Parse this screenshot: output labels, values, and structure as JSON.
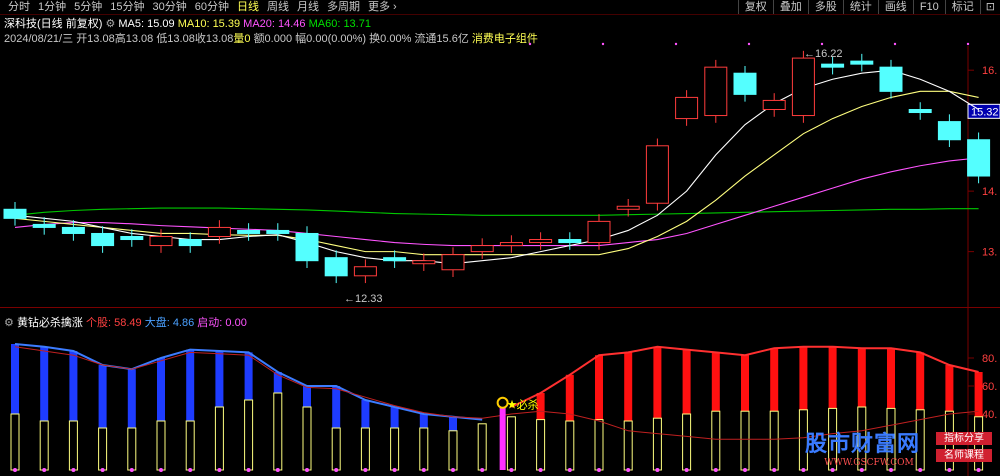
{
  "topbar": {
    "periods": [
      "分时",
      "1分钟",
      "5分钟",
      "15分钟",
      "30分钟",
      "60分钟",
      "日线",
      "周线",
      "月线",
      "多周期",
      "更多 ›"
    ],
    "active_period": "日线",
    "tools": [
      "复权",
      "叠加",
      "多股",
      "统计",
      "画线",
      "F10",
      "标记"
    ],
    "icon": "expand-icon"
  },
  "header": {
    "stock": "深科技(日线 前复权)",
    "ma5": "MA5: 15.09",
    "ma10": "MA10: 15.39",
    "ma20": "MA20: 14.46",
    "ma60": "MA60: 13.71",
    "date": "2024/08/21/三",
    "open": "开13.08",
    "high": "高13.08",
    "low": "低13.08",
    "close": "收13.08",
    "vol": "量0",
    "amount": "额0.000",
    "range": "幅0.00(0.00%)",
    "turnover": "换0.00%",
    "float": "流通15.6亿",
    "sector": "消费电子组件"
  },
  "price_axis": {
    "labels": [
      "16.",
      "14.",
      "13."
    ],
    "current": "15.32",
    "high_label": "16.22",
    "low_label": "12.33"
  },
  "indicator": {
    "name": "黄钻必杀擒涨",
    "stock_label": "个股: 58.49",
    "market_label": "大盘: 4.86",
    "start_label": "启动: 0.00",
    "signal": "必杀",
    "axis": [
      "80.",
      "60.",
      "40."
    ]
  },
  "colors": {
    "up": "#ff3c3c",
    "down": "#54ffff",
    "ma5": "#ffffff",
    "ma10": "#ffff7f",
    "ma20": "#ff54ff",
    "ma60": "#00c800",
    "bar_blue": "#1e3cff",
    "bar_red": "#ff1010"
  },
  "watermark": {
    "text": "股市财富网",
    "url": "WWW.GSCFW.COM",
    "tag1": "指标分享",
    "tag2": "名师课程"
  },
  "chart_data": {
    "type": "candlestick",
    "candles": [
      {
        "o": 13.7,
        "c": 13.55
      },
      {
        "o": 13.45,
        "c": 13.4
      },
      {
        "o": 13.4,
        "c": 13.3
      },
      {
        "o": 13.3,
        "c": 13.1
      },
      {
        "o": 13.25,
        "c": 13.2
      },
      {
        "o": 13.1,
        "c": 13.25
      },
      {
        "o": 13.2,
        "c": 13.1
      },
      {
        "o": 13.25,
        "c": 13.4
      },
      {
        "o": 13.35,
        "c": 13.3
      },
      {
        "o": 13.35,
        "c": 13.3
      },
      {
        "o": 13.3,
        "c": 12.85
      },
      {
        "o": 12.9,
        "c": 12.6
      },
      {
        "o": 12.6,
        "c": 12.75
      },
      {
        "o": 12.9,
        "c": 12.85
      },
      {
        "o": 12.8,
        "c": 12.85
      },
      {
        "o": 12.7,
        "c": 12.95
      },
      {
        "o": 13.0,
        "c": 13.1
      },
      {
        "o": 13.1,
        "c": 13.15
      },
      {
        "o": 13.15,
        "c": 13.2
      },
      {
        "o": 13.2,
        "c": 13.15
      },
      {
        "o": 13.15,
        "c": 13.5
      },
      {
        "o": 13.7,
        "c": 13.75
      },
      {
        "o": 13.8,
        "c": 14.75
      },
      {
        "o": 15.2,
        "c": 15.55
      },
      {
        "o": 15.25,
        "c": 16.05
      },
      {
        "o": 15.95,
        "c": 15.6
      },
      {
        "o": 15.35,
        "c": 15.5
      },
      {
        "o": 15.25,
        "c": 16.2
      },
      {
        "o": 16.1,
        "c": 16.05
      },
      {
        "o": 16.15,
        "c": 16.1
      },
      {
        "o": 16.05,
        "c": 15.65
      },
      {
        "o": 15.35,
        "c": 15.3
      },
      {
        "o": 15.15,
        "c": 14.85
      },
      {
        "o": 14.85,
        "c": 14.25
      }
    ],
    "ma5": [
      13.6,
      13.55,
      13.5,
      13.4,
      13.3,
      13.25,
      13.2,
      13.2,
      13.25,
      13.28,
      13.15,
      13.0,
      12.9,
      12.85,
      12.85,
      12.8,
      12.85,
      12.9,
      13.0,
      13.1,
      13.2,
      13.35,
      13.6,
      14.0,
      14.6,
      15.1,
      15.45,
      15.7,
      15.85,
      15.95,
      16.0,
      15.85,
      15.65,
      15.35
    ],
    "ma10": [
      13.55,
      13.5,
      13.45,
      13.4,
      13.35,
      13.3,
      13.3,
      13.28,
      13.27,
      13.27,
      13.2,
      13.1,
      13.0,
      13.0,
      12.95,
      12.95,
      12.95,
      12.95,
      12.95,
      12.95,
      12.95,
      13.05,
      13.25,
      13.5,
      13.85,
      14.25,
      14.6,
      14.95,
      15.2,
      15.4,
      15.55,
      15.65,
      15.65,
      15.55
    ],
    "ma20": [
      13.4,
      13.45,
      13.48,
      13.48,
      13.46,
      13.43,
      13.41,
      13.39,
      13.37,
      13.35,
      13.3,
      13.25,
      13.2,
      13.15,
      13.12,
      13.1,
      13.1,
      13.1,
      13.1,
      13.1,
      13.1,
      13.15,
      13.2,
      13.3,
      13.45,
      13.6,
      13.75,
      13.9,
      14.05,
      14.2,
      14.32,
      14.42,
      14.5,
      14.55
    ],
    "ma60": [
      13.6,
      13.65,
      13.68,
      13.7,
      13.71,
      13.72,
      13.72,
      13.72,
      13.71,
      13.7,
      13.69,
      13.67,
      13.65,
      13.63,
      13.62,
      13.61,
      13.6,
      13.6,
      13.6,
      13.6,
      13.6,
      13.61,
      13.62,
      13.63,
      13.64,
      13.65,
      13.66,
      13.67,
      13.68,
      13.69,
      13.7,
      13.7,
      13.71,
      13.71
    ],
    "yellow_bars": [
      40,
      35,
      35,
      30,
      30,
      35,
      35,
      45,
      50,
      55,
      45,
      30,
      30,
      30,
      30,
      28,
      33,
      38,
      36,
      35,
      36,
      35,
      37,
      40,
      42,
      42,
      42,
      43,
      44,
      45,
      44,
      43,
      42,
      38
    ],
    "bar_tops": [
      90,
      88,
      85,
      75,
      72,
      80,
      86,
      85,
      84,
      70,
      60,
      60,
      50,
      45,
      40,
      38,
      36,
      45,
      55,
      68,
      82,
      84,
      88,
      86,
      84,
      82,
      87,
      88,
      88,
      87,
      87,
      84,
      75,
      70
    ],
    "line": [
      88,
      85,
      82,
      75,
      72,
      78,
      84,
      83,
      82,
      68,
      59,
      58,
      52,
      46,
      41,
      38,
      37,
      40,
      42,
      40,
      35,
      28,
      26,
      24,
      22,
      22,
      22,
      23,
      26,
      28,
      32,
      36,
      40,
      42
    ],
    "bar_color": [
      "blue",
      "blue",
      "blue",
      "blue",
      "blue",
      "blue",
      "blue",
      "blue",
      "blue",
      "blue",
      "blue",
      "blue",
      "blue",
      "blue",
      "blue",
      "blue",
      "none",
      "none",
      "red",
      "red",
      "red",
      "red",
      "red",
      "red",
      "red",
      "red",
      "red",
      "red",
      "red",
      "red",
      "red",
      "red",
      "red",
      "red"
    ]
  }
}
